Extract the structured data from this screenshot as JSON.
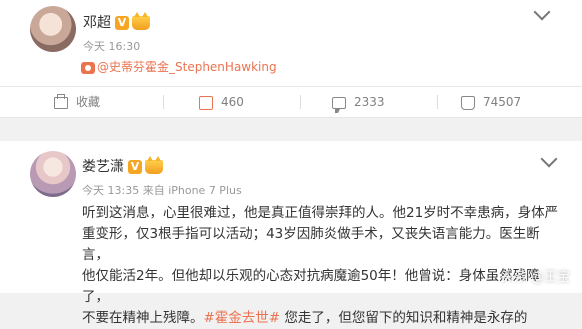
{
  "post1": {
    "username": "邓超",
    "badge": "V",
    "time": "今天 16:30",
    "mention": "@史蒂芬霍金_StephenHawking"
  },
  "actions": {
    "favorite": "收藏",
    "repost": "460",
    "comment": "2333",
    "like": "74507"
  },
  "post2": {
    "username": "娄艺潇",
    "badge": "V",
    "meta": "今天 13:35 来自 iPhone 7 Plus",
    "text_lines": [
      "听到这消息，心里很难过，他是真正值得崇拜的人。他21岁时不幸患病，身体严",
      "重变形，仅3根手指可以活动；43岁因肺炎做手术，又丧失语言能力。医生断言，",
      "他仅能活2年。但他却以乐观的心态对抗病魔逾50年！他曾说：身体虽然残障了，",
      "不要在精神上残障。"
    ],
    "hashtag": "#霍金去世#",
    "tail": " 您走了，但您留下的知识和精神是永存的"
  },
  "watermark": "头条 @王宝"
}
